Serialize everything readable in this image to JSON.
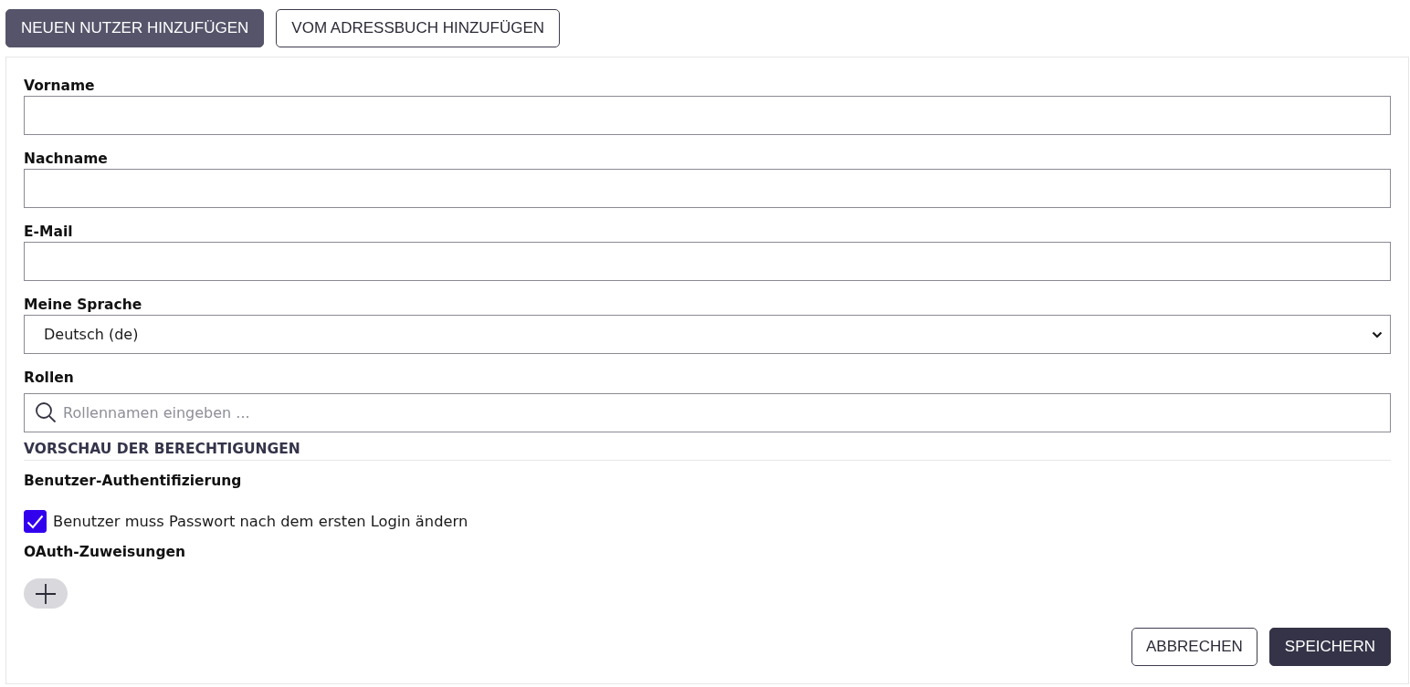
{
  "tabs": [
    {
      "label": "NEUEN NUTZER HINZUFÜGEN",
      "selected": true
    },
    {
      "label": "VOM ADRESSBUCH HINZUFÜGEN",
      "selected": false
    }
  ],
  "fields": [
    {
      "kind": "text",
      "label": "Vorname"
    },
    {
      "kind": "text",
      "label": "Nachname"
    },
    {
      "kind": "text",
      "label": "E-Mail"
    },
    {
      "kind": "select",
      "label": "Meine Sprache",
      "value": "Deutsch (de)"
    },
    {
      "kind": "search",
      "label": "Rollen",
      "placeholder": "Rollennamen eingeben ..."
    }
  ],
  "permissions": {
    "title": "VORSCHAU DER BERECHTIGUNGEN",
    "authentication": {
      "title": "Benutzer-Authentifizierung",
      "options": [
        {
          "label": "Benutzer muss Passwort nach dem ersten Login ändern",
          "checked": true
        }
      ]
    },
    "oauth": {
      "title": "OAuth-Zuweisungen"
    }
  },
  "actions": [
    {
      "kind": "secondary",
      "label": "ABBRECHEN"
    },
    {
      "kind": "primary",
      "label": "SPEICHERN"
    }
  ]
}
